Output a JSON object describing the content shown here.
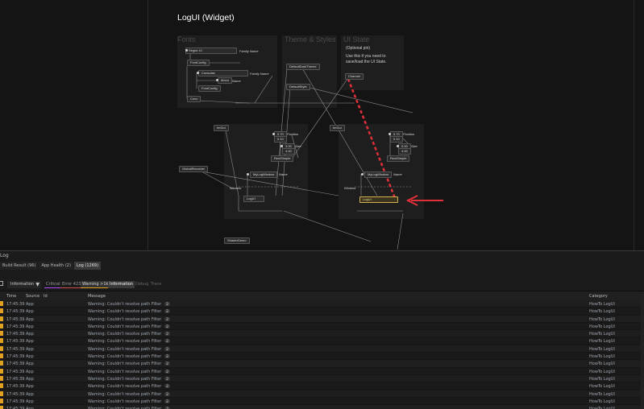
{
  "canvas": {
    "title": "LogUI (Widget)",
    "groups": {
      "fonts": "Fonts",
      "theme": "Theme & Styles",
      "uistate": "UI State"
    },
    "uistate_text": [
      "(Optional pin)",
      "Use this if you need to",
      "save/load the UI State."
    ],
    "nodes": {
      "segoe": "Segoe UI",
      "fontconfig1": "FontConfig",
      "consolas": "Consolas",
      "mono": "Mono",
      "fontconfig2": "FontConfig",
      "conv": "Conv",
      "darktheme": "DefaultDarkTheme",
      "defaultstyle": "DefaultStyle",
      "channel": "Channel",
      "imgui_left": "ImGui",
      "imgui_right": "ImGui",
      "vec_left_1a": "0.70",
      "vec_left_1b": "0.10",
      "vec_left_2a": "3.00",
      "vec_left_2b": "4.00",
      "vec_right_1a": "5.70",
      "vec_right_1b": "0.10",
      "vec_right_2a": "5.00",
      "vec_right_2b": "4.00",
      "rectangle_left": "RectSimple",
      "rectangle_right": "RectSimple",
      "globalrecorder": "GlobalRecorder",
      "mylogwindow_left": "MyLogWindow",
      "mylogwindow_right": "MyLogWindow",
      "window_left": "Window",
      "window_right": "Window",
      "logui_left": "LogUI",
      "logui_right": "LogUI",
      "shaderdemo": "ShaderDemo"
    },
    "labels": {
      "family_name_1": "Family Name",
      "name_1": "Name",
      "family_name_2": "Family Name",
      "position_left": "Position",
      "size_left": "Size",
      "name_left": "Name",
      "position_right": "Position",
      "size_right": "Size",
      "name_right": "Name"
    },
    "colors": {
      "arrow": "#e0303a",
      "selected": "#d3b24d"
    }
  },
  "log_panel": {
    "title": "Log",
    "tabs": [
      "Build Result (96)",
      "App Health (2)",
      "Log (1269)"
    ],
    "active_tab": 2,
    "level": "Information",
    "level_icon": "chevron-down-icon",
    "filters": {
      "critical": "Critical",
      "error": "Error 423",
      "warning": "Warning >1k",
      "information": "Information",
      "debug": "Debug",
      "trace": "Trace"
    },
    "columns": {
      "time": "Time",
      "source": "Source",
      "id": "Id",
      "message": "Message",
      "category": "Category"
    },
    "rows": [
      {
        "time": "17:45:39",
        "source": "App",
        "message": "Warning: Couldn't resolve path Filter",
        "count": "2",
        "category": "HowTo LogUI"
      },
      {
        "time": "17:45:39",
        "source": "App",
        "message": "Warning: Couldn't resolve path Filter",
        "count": "2",
        "category": "HowTo LogUI"
      },
      {
        "time": "17:45:39",
        "source": "App",
        "message": "Warning: Couldn't resolve path Filter",
        "count": "2",
        "category": "HowTo LogUI"
      },
      {
        "time": "17:45:39",
        "source": "App",
        "message": "Warning: Couldn't resolve path Filter",
        "count": "2",
        "category": "HowTo LogUI"
      },
      {
        "time": "17:45:39",
        "source": "App",
        "message": "Warning: Couldn't resolve path Filter",
        "count": "2",
        "category": "HowTo LogUI"
      },
      {
        "time": "17:45:39",
        "source": "App",
        "message": "Warning: Couldn't resolve path Filter",
        "count": "2",
        "category": "HowTo LogUI"
      },
      {
        "time": "17:45:39",
        "source": "App",
        "message": "Warning: Couldn't resolve path Filter",
        "count": "2",
        "category": "HowTo LogUI"
      },
      {
        "time": "17:45:39",
        "source": "App",
        "message": "Warning: Couldn't resolve path Filter",
        "count": "2",
        "category": "HowTo LogUI"
      },
      {
        "time": "17:45:39",
        "source": "App",
        "message": "Warning: Couldn't resolve path Filter",
        "count": "2",
        "category": "HowTo LogUI"
      },
      {
        "time": "17:45:39",
        "source": "App",
        "message": "Warning: Couldn't resolve path Filter",
        "count": "2",
        "category": "HowTo LogUI"
      },
      {
        "time": "17:45:39",
        "source": "App",
        "message": "Warning: Couldn't resolve path Filter",
        "count": "2",
        "category": "HowTo LogUI"
      },
      {
        "time": "17:45:39",
        "source": "App",
        "message": "Warning: Couldn't resolve path Filter",
        "count": "2",
        "category": "HowTo LogUI"
      },
      {
        "time": "17:45:39",
        "source": "App",
        "message": "Warning: Couldn't resolve path Filter",
        "count": "2",
        "category": "HowTo LogUI"
      },
      {
        "time": "17:45:39",
        "source": "App",
        "message": "Warning: Couldn't resolve path Filter",
        "count": "2",
        "category": "HowTo LogUI"
      },
      {
        "time": "17:45:39",
        "source": "App",
        "message": "Warning: Couldn't resolve path Filter",
        "count": "2",
        "category": "HowTo LogUI"
      },
      {
        "time": "17:45:39",
        "source": "App",
        "message": "Warning: Couldn't resolve path Filter",
        "count": "2",
        "category": "HowTo LogUI"
      }
    ]
  }
}
